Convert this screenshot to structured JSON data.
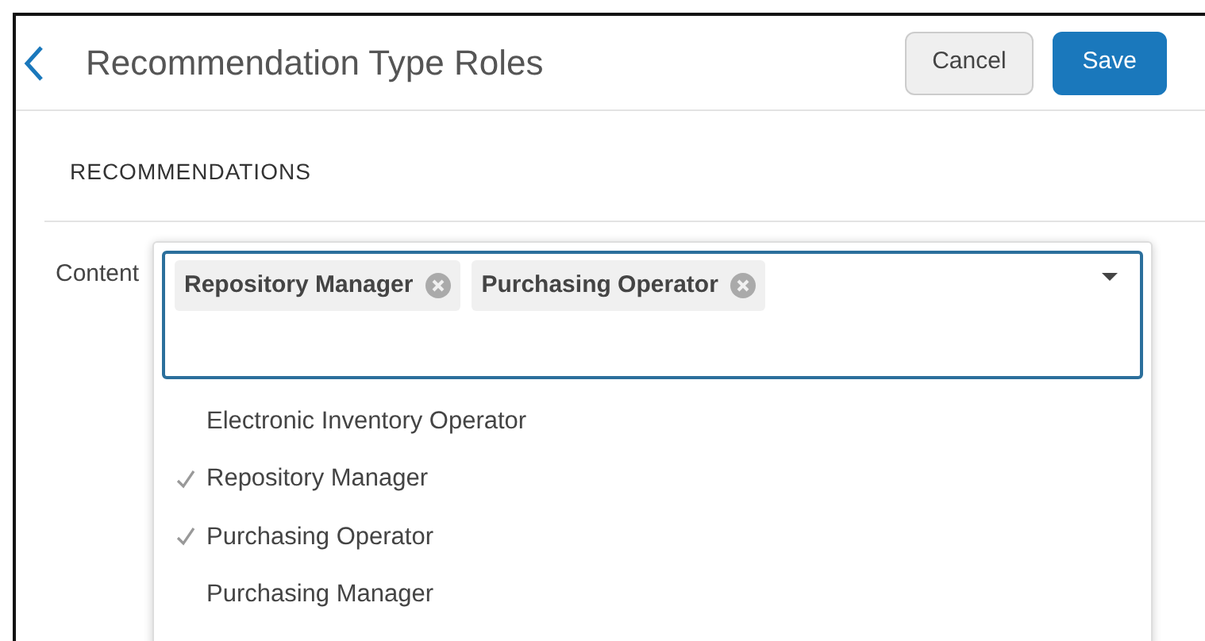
{
  "header": {
    "title": "Recommendation Type Roles",
    "buttons": [
      {
        "label": "Cancel",
        "kind": "secondary"
      },
      {
        "label": "Save",
        "kind": "primary"
      }
    ]
  },
  "section": {
    "title": "RECOMMENDATIONS"
  },
  "field": {
    "label": "Content",
    "tags": [
      "Repository Manager",
      "Purchasing Operator"
    ],
    "options": [
      {
        "label": "Electronic Inventory Operator",
        "selected": false
      },
      {
        "label": "Repository Manager",
        "selected": true
      },
      {
        "label": "Purchasing Operator",
        "selected": true
      },
      {
        "label": "Purchasing Manager",
        "selected": false
      }
    ]
  }
}
